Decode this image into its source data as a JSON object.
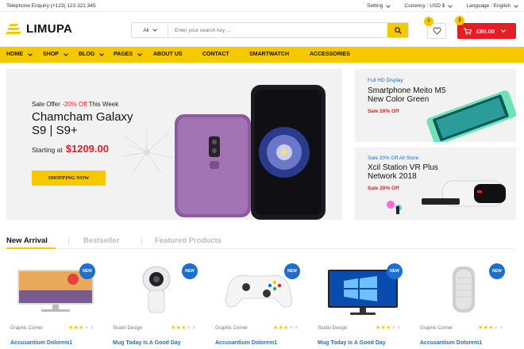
{
  "topbar": {
    "telephone": "Telephone Enquiry:(+123) 123 321 345",
    "setting": "Setting",
    "currency": "Currency : USD $",
    "language": "Language : English"
  },
  "header": {
    "logo": "LIMUPA",
    "search_category": "All",
    "search_placeholder": "Enter your search key ...",
    "wishlist_count": "0",
    "cart_count": "2",
    "cart_total": "£80.00"
  },
  "nav": {
    "items": [
      "HOME",
      "SHOP",
      "BLOG",
      "PAGES",
      "ABOUT US",
      "CONTACT",
      "SMARTWATCH",
      "ACCESSORIES"
    ]
  },
  "hero": {
    "offer_prefix": "Sale Offer",
    "offer_discount": "-20% Off",
    "offer_suffix": "This Week",
    "title_line1": "Chamcham Galaxy",
    "title_line2": "S9 | S9+",
    "starting_at": "Starting at",
    "price": "$1209.00",
    "button": "SHOPPING NOW"
  },
  "banners": [
    {
      "tag": "Full HD Display",
      "title_line1": "Smartphone Meito M5",
      "title_line2": "New Color Green",
      "sale": "Sale 20% Off"
    },
    {
      "tag": "Sale 20% Off All Store",
      "title_line1": "Xcil Station VR Plus",
      "title_line2": "Network 2018",
      "sale": "Sale 20% Off"
    }
  ],
  "tabs": [
    "New Arrival",
    "Bestseller",
    "Featured Products"
  ],
  "products": [
    {
      "badge": "NEW",
      "brand": "Graphic Corner",
      "rating": 3,
      "name": "Accusantium Dolorem1"
    },
    {
      "badge": "NEW",
      "brand": "Studio Design",
      "rating": 3,
      "name": "Mug Today Is A Good Day"
    },
    {
      "badge": "NEW",
      "brand": "Graphic Corner",
      "rating": 3,
      "name": "Accusantium Dolorem1"
    },
    {
      "badge": "NEW",
      "brand": "Studio Design",
      "rating": 3,
      "name": "Mug Today Is A Good Day"
    },
    {
      "badge": "NEW",
      "brand": "Graphic Corner",
      "rating": 3,
      "name": "Accusantium Dolorem1"
    }
  ],
  "colors": {
    "accent": "#f5c800",
    "sale": "#e31e24",
    "link": "#1a6fd0"
  }
}
